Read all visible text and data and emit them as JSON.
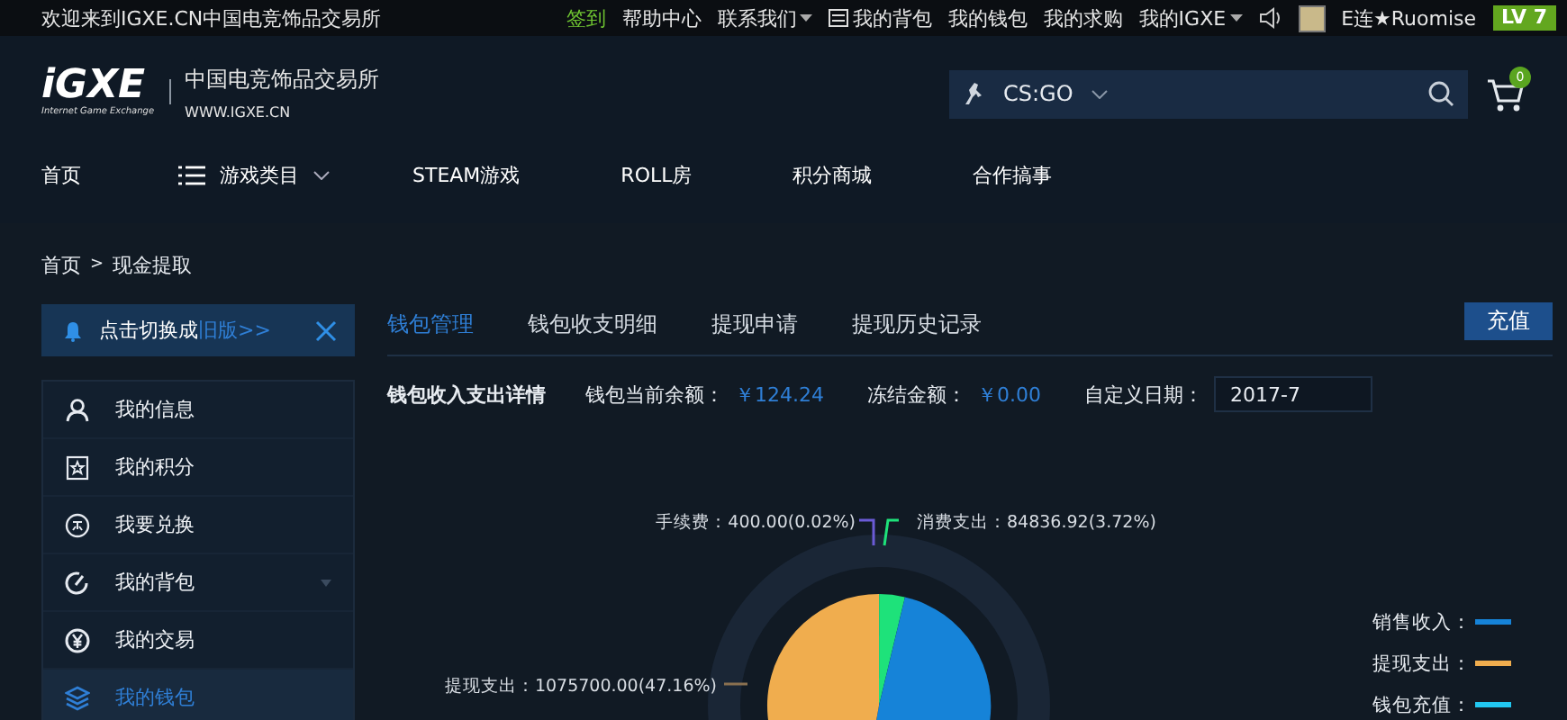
{
  "top_bar": {
    "welcome": "欢迎来到IGXE.CN中国电竞饰品交易所",
    "links": [
      {
        "label": "签到",
        "kind": "highlight"
      },
      {
        "label": "帮助中心",
        "kind": "plain"
      },
      {
        "label": "联系我们",
        "kind": "dropdown"
      },
      {
        "label": "我的背包",
        "kind": "icon"
      },
      {
        "label": "我的钱包",
        "kind": "plain"
      },
      {
        "label": "我的求购",
        "kind": "plain"
      },
      {
        "label": "我的IGXE",
        "kind": "dropdown"
      }
    ],
    "username": "E连★Ruomise",
    "level": "LV 7"
  },
  "header": {
    "logo": "iGXE",
    "logo_tagline": "Internet Game Exchange",
    "site_name": "中国电竞饰品交易所",
    "site_url": "WWW.IGXE.CN",
    "game_select": "CS:GO",
    "cart_count": "0"
  },
  "nav": [
    {
      "label": "首页",
      "kind": "plain"
    },
    {
      "label": "游戏类目",
      "kind": "menu"
    },
    {
      "label": "STEAM游戏",
      "kind": "plain"
    },
    {
      "label": "ROLL房",
      "kind": "plain"
    },
    {
      "label": "积分商城",
      "kind": "plain"
    },
    {
      "label": "合作搞事",
      "kind": "plain"
    }
  ],
  "breadcrumb": {
    "items": [
      "首页",
      "现金提取"
    ],
    "separator": ">"
  },
  "sidebar": {
    "notice": {
      "text": "点击切换成",
      "link": "旧版>>"
    },
    "items": [
      {
        "label": "我的信息",
        "selected": false
      },
      {
        "label": "我的积分",
        "selected": false
      },
      {
        "label": "我要兑换",
        "selected": false
      },
      {
        "label": "我的背包",
        "selected": false,
        "expanded": false
      },
      {
        "label": "我的交易",
        "selected": false
      },
      {
        "label": "我的钱包",
        "selected": true
      }
    ]
  },
  "tabs": [
    {
      "label": "钱包管理",
      "selected": true
    },
    {
      "label": "钱包收支明细",
      "selected": false
    },
    {
      "label": "提现申请",
      "selected": false
    },
    {
      "label": "提现历史记录",
      "selected": false
    }
  ],
  "recharge_button": "充值",
  "summary": {
    "title": "钱包收入支出详情",
    "balance_label": "钱包当前余额：",
    "balance": "￥124.24",
    "frozen_label": "冻结金额：",
    "frozen": "￥0.00",
    "date_label": "自定义日期：",
    "date": "2017-7"
  },
  "pie_chart": {
    "slice_labels": [
      "手续费：400.00(0.02%)",
      "消费支出：84836.92(3.72%)",
      "提现支出：1075700.00(47.16%)"
    ],
    "legend": [
      {
        "label": "销售收入：",
        "color": "#1683d8"
      },
      {
        "label": "提现支出：",
        "color": "#f0ad4e"
      },
      {
        "label": "钱包充值：",
        "color": "#22c7f0"
      }
    ]
  }
}
